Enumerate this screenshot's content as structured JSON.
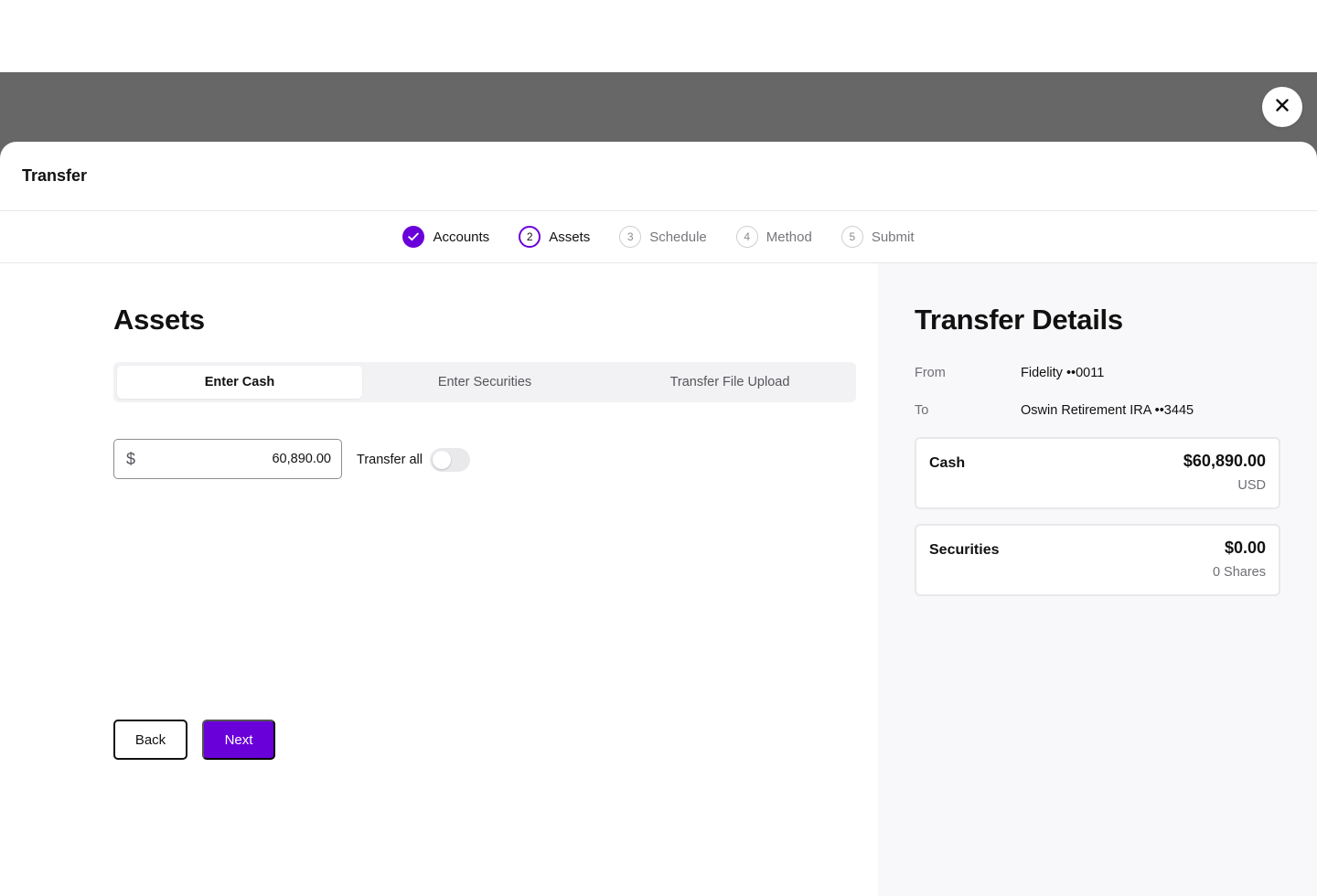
{
  "modal": {
    "title": "Transfer"
  },
  "stepper": {
    "steps": [
      {
        "number": "1",
        "label": "Accounts",
        "state": "done"
      },
      {
        "number": "2",
        "label": "Assets",
        "state": "active"
      },
      {
        "number": "3",
        "label": "Schedule",
        "state": "pending"
      },
      {
        "number": "4",
        "label": "Method",
        "state": "pending"
      },
      {
        "number": "5",
        "label": "Submit",
        "state": "pending"
      }
    ]
  },
  "assets": {
    "title": "Assets",
    "tabs": [
      {
        "label": "Enter Cash",
        "selected": true
      },
      {
        "label": "Enter Securities",
        "selected": false
      },
      {
        "label": "Transfer File Upload",
        "selected": false
      }
    ],
    "amount": {
      "prefix": "$",
      "value": "60,890.00"
    },
    "transfer_all": {
      "label": "Transfer all",
      "on": false
    },
    "back_label": "Back",
    "next_label": "Next"
  },
  "details": {
    "title": "Transfer Details",
    "from_label": "From",
    "from_value": "Fidelity ••0011",
    "to_label": "To",
    "to_value": "Oswin Retirement IRA ••3445",
    "cash": {
      "label": "Cash",
      "amount": "$60,890.00",
      "sub": "USD"
    },
    "securities": {
      "label": "Securities",
      "amount": "$0.00",
      "sub": "0 Shares"
    }
  },
  "colors": {
    "accent": "#6a00d9",
    "overlay": "#676767",
    "panel_bg": "#f8f8fa"
  },
  "icons": {
    "close": "close-icon",
    "done_step": "check-icon"
  }
}
